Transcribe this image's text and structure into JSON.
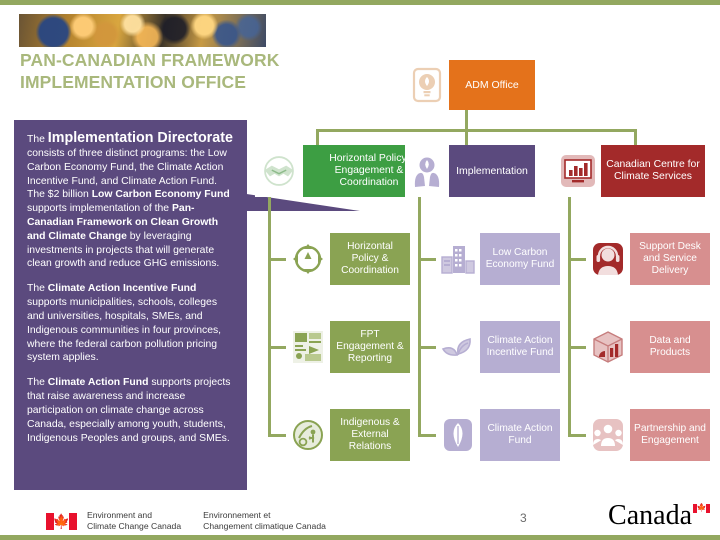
{
  "slide": {
    "title": "PAN-CANADIAN FRAMEWORK\nIMPLEMENTATION OFFICE",
    "page_number": "3",
    "accent_green": "#93a860",
    "panel_purple": "#5b4a7e",
    "title_color": "#a9b87c"
  },
  "header_image": {
    "name": "bokeh-photo-strip"
  },
  "left_panel": {
    "para1": {
      "lead": "The ",
      "bold_title": "Implementation Directorate",
      "rest_a": " consists of three distinct programs: the Low Carbon Economy Fund, the Climate Action Incentive Fund, and Climate Action Fund. The $2 billion ",
      "bold_b": "Low Carbon Economy Fund",
      "rest_b": " supports implementation of the ",
      "bold_c": "Pan-Canadian Framework on Clean Growth and Climate Change",
      "rest_c": " by leveraging investments in projects that will generate clean growth and reduce GHG emissions."
    },
    "para2": {
      "lead": "The ",
      "bold": "Climate Action Incentive Fund",
      "rest": " supports municipalities, schools, colleges and universities, hospitals, SMEs, and Indigenous communities in four provinces, where the federal carbon pollution pricing system applies."
    },
    "para3": {
      "lead": "The ",
      "bold": "Climate Action Fund",
      "rest": " supports projects that raise awareness and increase participation on climate change across Canada, especially among youth, students, Indigenous Peoples and groups, and SMEs."
    }
  },
  "org_chart": {
    "root": {
      "label": "ADM Office",
      "icon": "lightbulb-icon",
      "color": "#e4721b"
    },
    "branches": [
      {
        "label": "Horizontal Policy, Engagement & Coordination",
        "icon": "handshake-icon",
        "color": "#3d9e43",
        "children": [
          {
            "label": "Horizontal Policy & Coordination",
            "icon": "compass-icon",
            "color": "#8aa353"
          },
          {
            "label": "FPT Engagement & Reporting",
            "icon": "documents-icon",
            "color": "#8aa353"
          },
          {
            "label": "Indigenous & External Relations",
            "icon": "indigenous-emblem-icon",
            "color": "#8aa353"
          }
        ]
      },
      {
        "label": "Implementation",
        "icon": "hands-lightbulb-icon",
        "color": "#5b4a7e",
        "children": [
          {
            "label": "Low Carbon Economy Fund",
            "icon": "buildings-icon",
            "color": "#b6aed2"
          },
          {
            "label": "Climate Action Incentive Fund",
            "icon": "leaf-sprout-icon",
            "color": "#b6aed2"
          },
          {
            "label": "Climate Action Fund",
            "icon": "leaf-icon",
            "color": "#b6aed2"
          }
        ]
      },
      {
        "label": "Canadian Centre for Climate Services",
        "icon": "monitor-chart-icon",
        "color": "#a32a2a",
        "children": [
          {
            "label": "Support Desk and Service Delivery",
            "icon": "headset-agent-icon",
            "color": "#d78f8f"
          },
          {
            "label": "Data and Products",
            "icon": "data-cube-icon",
            "color": "#d78f8f"
          },
          {
            "label": "Partnership and Engagement",
            "icon": "people-group-icon",
            "color": "#d78f8f"
          }
        ]
      }
    ]
  },
  "footer": {
    "dept_en": "Environment and\nClimate Change Canada",
    "dept_fr": "Environnement et\nChangement climatique Canada",
    "wordmark": "Canada",
    "flag_icon": "canada-flag-icon"
  }
}
